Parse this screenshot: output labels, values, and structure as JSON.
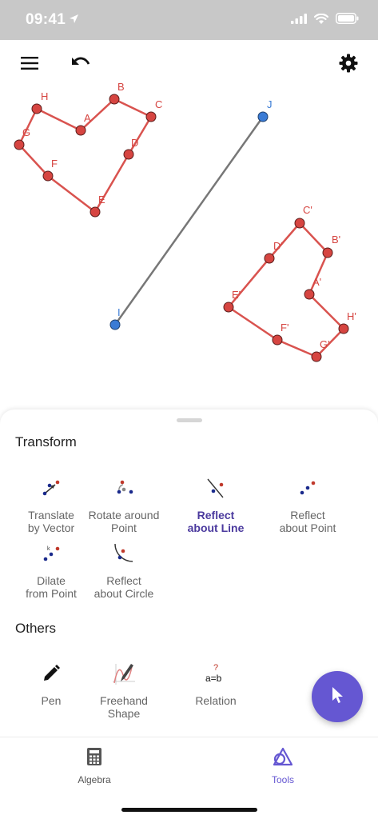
{
  "status": {
    "time": "09:41"
  },
  "toolbar": {
    "menu_icon": "menu-icon",
    "undo_icon": "undo-icon",
    "settings_icon": "gear-icon"
  },
  "canvas": {
    "points": [
      "A",
      "B",
      "C",
      "D",
      "E",
      "F",
      "G",
      "H",
      "I",
      "J"
    ],
    "reflected_points": [
      "A'",
      "B'",
      "C'",
      "D'",
      "E'",
      "F'",
      "G'",
      "H'"
    ],
    "colors": {
      "polygon": "#d9534f",
      "point": "#d64541",
      "line_point": "#3a7bd5",
      "line": "#777777"
    }
  },
  "sheet": {
    "transform_title": "Transform",
    "transform_tools": [
      {
        "label": "Translate\nby Vector",
        "icon": "translate-vector-icon"
      },
      {
        "label": "Rotate around\nPoint",
        "icon": "rotate-point-icon"
      },
      {
        "label": "Reflect\nabout Line",
        "icon": "reflect-line-icon",
        "active": true
      },
      {
        "label": "Reflect\nabout Point",
        "icon": "reflect-point-icon"
      },
      {
        "label": "Dilate\nfrom Point",
        "icon": "dilate-icon"
      },
      {
        "label": "Reflect\nabout Circle",
        "icon": "reflect-circle-icon"
      }
    ],
    "others_title": "Others",
    "other_tools": [
      {
        "label": "Pen",
        "icon": "pen-icon"
      },
      {
        "label": "Freehand\nShape",
        "icon": "freehand-icon"
      },
      {
        "label": "Relation",
        "icon": "relation-icon"
      }
    ]
  },
  "fab": {
    "icon": "cursor-icon"
  },
  "nav": {
    "items": [
      {
        "label": "Algebra",
        "icon": "calculator-icon"
      },
      {
        "label": "Tools",
        "icon": "tools-icon",
        "active": true
      }
    ]
  },
  "accent": "#6557d2"
}
